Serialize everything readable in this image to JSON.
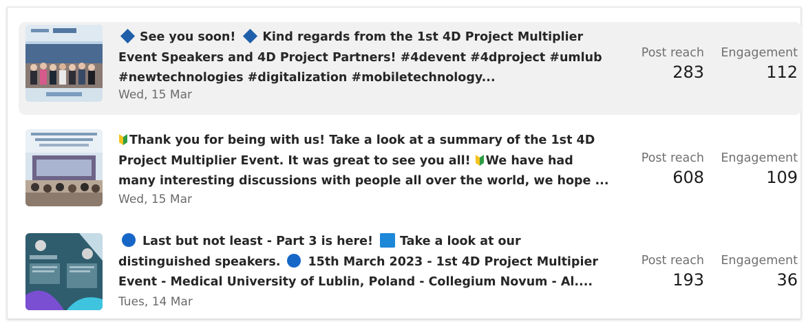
{
  "posts": [
    {
      "lines": [
        "See you soon!",
        "Kind regards from the 1st 4D Project Multiplier",
        "Event Speakers and 4D Project Partners! #4devent #4dproject #umlub",
        "#newtechnologies #digitalization #mobiletechnology..."
      ],
      "date": "Wed, 15 Mar",
      "reach_label": "Post reach",
      "reach": "283",
      "engagement_label": "Engagement",
      "engagement": "112",
      "icons": [
        "blue-diamond-icon",
        "blue-diamond-icon"
      ]
    },
    {
      "lines": [
        "Thank you for being with us! Take a look at a summary of the 1st 4D",
        "Project Multiplier Event. It was great to see you all!",
        "We have had",
        "many interesting discussions with people all over the world, we hope ..."
      ],
      "date": "Wed, 15 Mar",
      "reach_label": "Post reach",
      "reach": "608",
      "engagement_label": "Engagement",
      "engagement": "109",
      "icons": [
        "japanese-beginner-symbol-icon",
        "japanese-beginner-symbol-icon"
      ]
    },
    {
      "lines": [
        "Last but not least - Part 3 is here!",
        "Take a look at our",
        "distinguished speakers.",
        "15th March 2023 - 1st 4D Project Multipier",
        "Event - Medical University of Lublin, Poland - Collegium Novum - Al...."
      ],
      "date": "Tues, 14 Mar",
      "reach_label": "Post reach",
      "reach": "193",
      "engagement_label": "Engagement",
      "engagement": "36",
      "icons": [
        "blue-circle-icon",
        "blue-square-icon",
        "blue-circle-icon"
      ]
    }
  ]
}
